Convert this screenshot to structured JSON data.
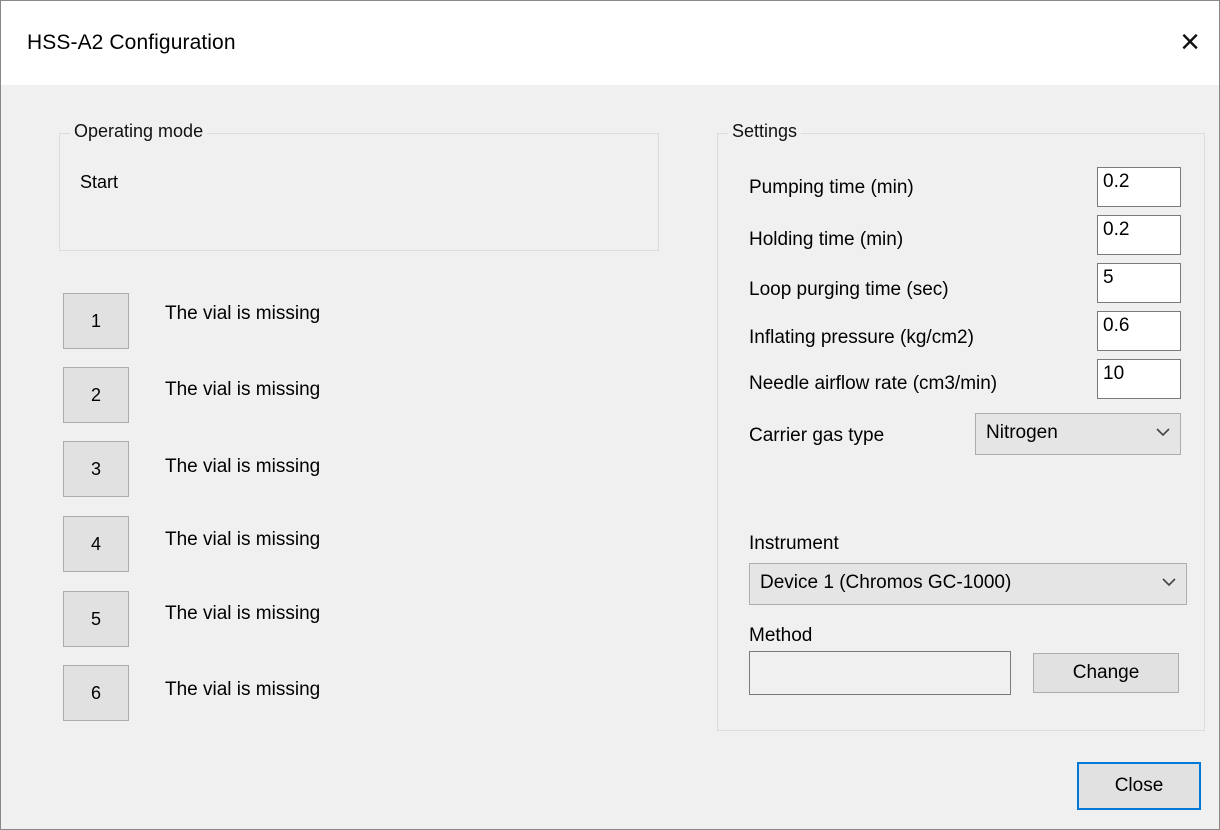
{
  "window": {
    "title": "HSS-A2 Configuration",
    "close_glyph": "×"
  },
  "operating_mode": {
    "legend": "Operating mode",
    "value": "Start"
  },
  "vials": [
    {
      "number": "1",
      "status": "The vial is missing"
    },
    {
      "number": "2",
      "status": "The vial is missing"
    },
    {
      "number": "3",
      "status": "The vial is missing"
    },
    {
      "number": "4",
      "status": "The vial is missing"
    },
    {
      "number": "5",
      "status": "The vial is missing"
    },
    {
      "number": "6",
      "status": "The vial is missing"
    }
  ],
  "settings": {
    "legend": "Settings",
    "fields": [
      {
        "label": "Pumping time (min)",
        "value": "0.2"
      },
      {
        "label": "Holding time (min)",
        "value": "0.2"
      },
      {
        "label": "Loop purging time (sec)",
        "value": "5"
      },
      {
        "label": "Inflating pressure (kg/cm2)",
        "value": "0.6"
      },
      {
        "label": "Needle airflow rate (cm3/min)",
        "value": "10"
      }
    ],
    "carrier_gas": {
      "label": "Carrier gas type",
      "value": "Nitrogen"
    },
    "instrument": {
      "label": "Instrument",
      "value": "Device 1 (Chromos GC-1000)"
    },
    "method": {
      "label": "Method",
      "value": "",
      "change_label": "Change"
    }
  },
  "footer": {
    "close_label": "Close"
  },
  "icons": {
    "dropdown": "chevron-down-icon",
    "close": "close-icon"
  },
  "colors": {
    "default_button_border": "#0078d7",
    "window_bg": "#f0f0f0",
    "titlebar_bg": "#ffffff"
  }
}
